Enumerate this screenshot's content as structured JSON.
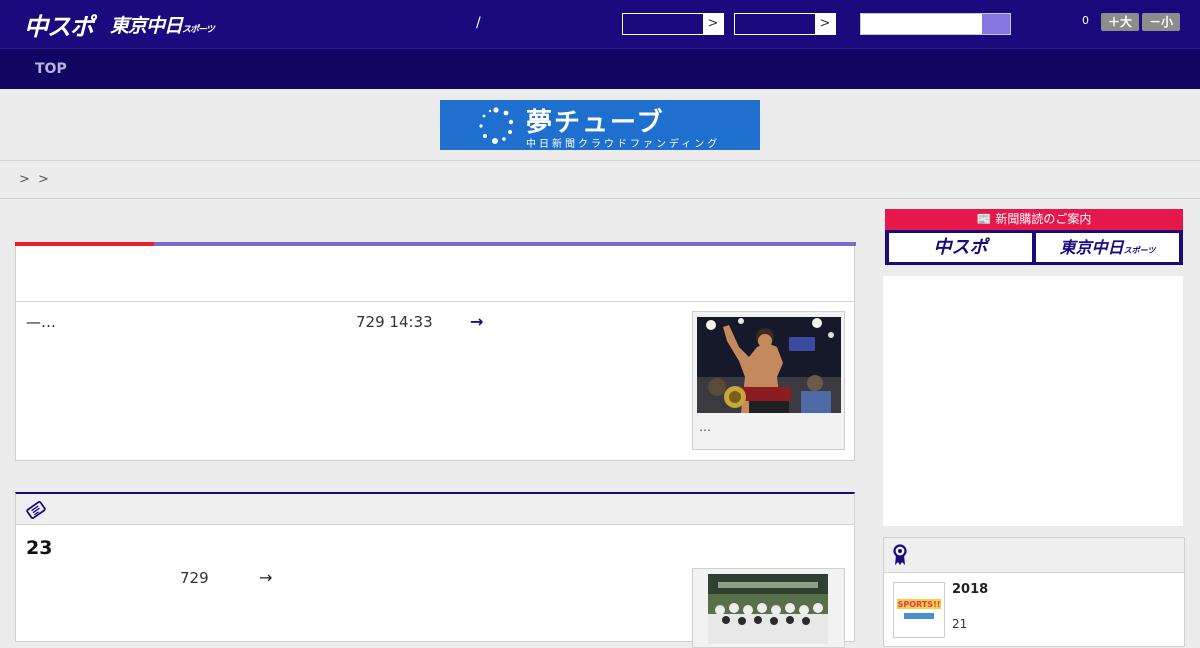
{
  "header": {
    "logo_primary": "中スポ",
    "logo_secondary": "東京中日",
    "logo_secondary_small": "スポーツ",
    "divider": "/",
    "select_arrow": ">",
    "font_count": "0",
    "font_large": "＋大",
    "font_small": "－小"
  },
  "nav": {
    "top_label": "TOP"
  },
  "banner": {
    "title": "夢チューブ",
    "subtitle": "中日新聞クラウドファンディング"
  },
  "breadcrumb": {
    "separators": [
      ">",
      ">"
    ]
  },
  "article1": {
    "lead": "—…",
    "date": "729 14:33",
    "more": "→",
    "photo_caption": "…"
  },
  "article2": {
    "number": "23",
    "date": "729",
    "more": "→"
  },
  "sidebar": {
    "subscription_header": "新聞購読のご案内",
    "subscription_left": "中スポ",
    "subscription_right": "東京中日",
    "subscription_right_small": "スポーツ",
    "feature_year": "2018",
    "feature_number": "21",
    "thumb_label": "SPORTS!!"
  },
  "colors": {
    "brand_navy": "#1b0a7d",
    "nav_dark": "#120561",
    "accent_red": "#e6222a",
    "accent_purple": "#7a6ccc",
    "subscription_pink": "#e6174a",
    "banner_blue": "#1e6fce"
  }
}
